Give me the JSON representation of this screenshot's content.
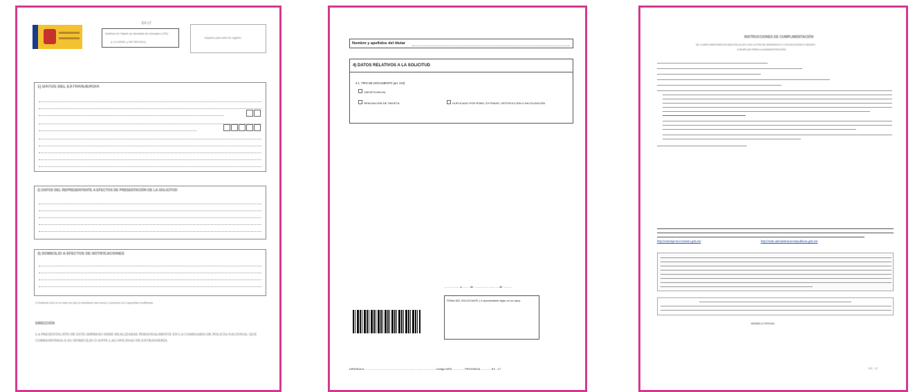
{
  "page1": {
    "form_code": "EX-17",
    "header_title": "Solicitud de Tarjeta de identidad de extranjero (TIE)",
    "header_law": "(L.O.4/2000, y RD 557/2011)",
    "stamp_label": "Espacio para sello de registro",
    "section1_title": "1) DATOS DEL EXTRANJERO/A",
    "section2_title": "2) DATOS DEL REPRESENTANTE A EFECTOS DE PRESENTACIÓN DE LA SOLICITUD",
    "section3_title": "3) DOMICILIO A EFECTOS DE NOTIFICACIONES",
    "footnote": "1) Rellenar solo en el caso de que el solicitante sea menor o persona con capacidad modificada",
    "notice_title": "DIRECCIÓN",
    "notice_text": "LA PRESENTACIÓN DE ESTE IMPRESO DEBE REALIZARSE PERSONALMENTE EN LA COMISARÍA DE POLICÍA NACIONAL QUE CORRESPONDA A SU DOMICILIO O ANTE LAS OFICINAS DE EXTRANJERÍA"
  },
  "page2": {
    "name_label": "Nombre y apellidos del titular",
    "section4_title": "4)  DATOS RELATIVOS A LA SOLICITUD",
    "doc_type_label": "4.1. TIPO DE DOCUMENTO (art. 210)",
    "option_initial": "TARJETA INICIAL",
    "option_renewal": "RENOVACIÓN DE TARJETA",
    "option_duplicate": "DUPLICADO POR ROBO, EXTRAVÍO, DESTRUCCIÓN O INUTILIZACIÓN",
    "date_line": "..................., a ......... de ................................ de ...........",
    "signature_label": "FIRMA DEL SOLICITANTE ( o representante legal, en su caso)",
    "footer_left": "DIRIGIDA A",
    "footer_code": "Código DIR3",
    "footer_province": "PROVINCIA",
    "footer_form": "EX - 17"
  },
  "page3": {
    "title": "INSTRUCCIONES DE CUMPLIMENTACIÓN",
    "subtitle": "SE CUMPLIMENTARÁ EN MAYÚSCULAS CON LETRA DE IMPRENTA O CON BOLÍGRAFO NEGRO",
    "subtitle2": "EJEMPLAR PARA LA ADMINISTRACIÓN",
    "info_link_1": "http://extranjeros.inclusion.gob.es/",
    "info_link_2": "http://sede.administracionespublicas.gob.es/",
    "bottom_note": "MODELO OFICIAL",
    "footer_form": "EX - 17"
  }
}
